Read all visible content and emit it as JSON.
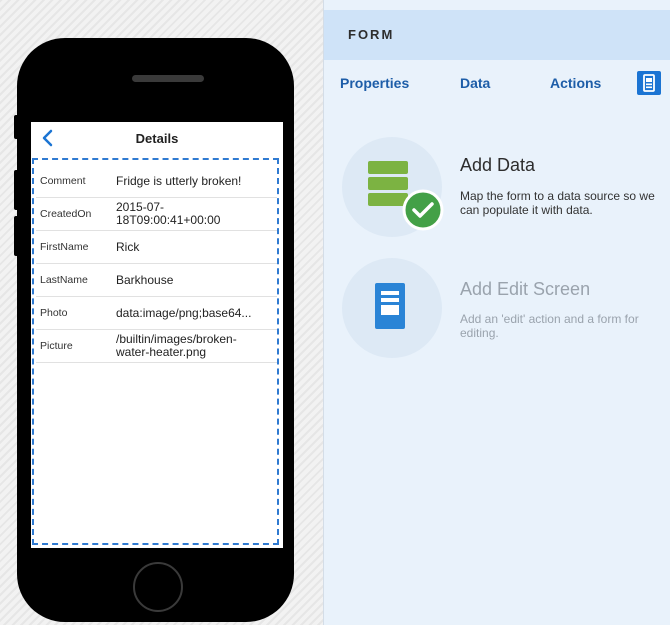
{
  "details_screen": {
    "title": "Details",
    "rows": [
      {
        "label": "Comment",
        "value": "Fridge is utterly broken!"
      },
      {
        "label": "CreatedOn",
        "value": "2015-07-\n18T09:00:41+00:00"
      },
      {
        "label": "FirstName",
        "value": "Rick"
      },
      {
        "label": "LastName",
        "value": "Barkhouse"
      },
      {
        "label": "Photo",
        "value": "data:image/png;base64..."
      },
      {
        "label": "Picture",
        "value": "/builtin/images/broken-\nwater-heater.png"
      }
    ]
  },
  "panel": {
    "title": "FORM",
    "tabs": {
      "properties": "Properties",
      "data": "Data",
      "actions": "Actions"
    },
    "add_data": {
      "title": "Add Data",
      "description": "Map the form to a data source so we can populate it with data."
    },
    "add_edit_screen": {
      "title": "Add Edit Screen",
      "description": "Add an 'edit' action and a form for editing."
    }
  },
  "colors": {
    "accent": "#1b74d3",
    "link": "#1d5da8",
    "dashed_border": "#2f7ad1",
    "green": "#7cb342",
    "check_green": "#43a047"
  },
  "icons": [
    "chevron-left-icon",
    "mobile-preview-icon",
    "database-icon",
    "checkmark-icon",
    "document-icon"
  ]
}
